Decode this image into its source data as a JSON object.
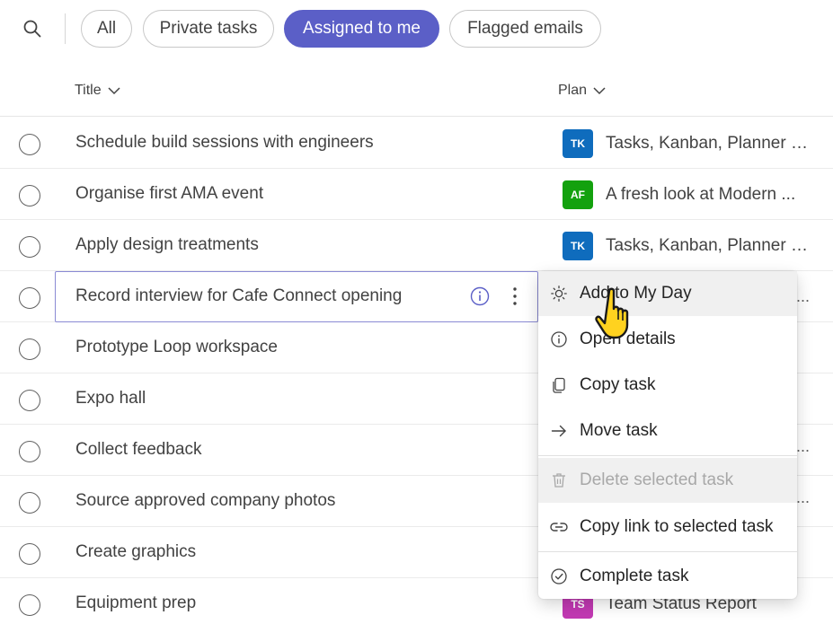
{
  "filters": {
    "all": "All",
    "private": "Private tasks",
    "assigned": "Assigned to me",
    "flagged": "Flagged emails"
  },
  "columns": {
    "title": "Title",
    "plan": "Plan"
  },
  "rows": [
    {
      "title": "Schedule build sessions with engineers",
      "badge": "TK",
      "badge_color": "#0f6cbd",
      "plan": "Tasks, Kanban, Planner i..."
    },
    {
      "title": "Organise first AMA event",
      "badge": "AF",
      "badge_color": "#13a10e",
      "plan": "A fresh look at Modern ..."
    },
    {
      "title": "Apply design treatments",
      "badge": "TK",
      "badge_color": "#0f6cbd",
      "plan": "Tasks, Kanban, Planner i..."
    },
    {
      "title": "Record interview for Cafe Connect opening",
      "trail": "..."
    },
    {
      "title": "Prototype Loop workspace"
    },
    {
      "title": "Expo hall"
    },
    {
      "title": "Collect feedback",
      "trail": "..."
    },
    {
      "title": "Source approved company photos",
      "trail": "..."
    },
    {
      "title": "Create graphics"
    },
    {
      "title": "Equipment prep",
      "badge": "TS",
      "badge_color": "#c239b3",
      "plan": "Team Status Report"
    }
  ],
  "menu": {
    "add_my_day": "Add to My Day",
    "open_details": "Open details",
    "copy_task": "Copy task",
    "move_task": "Move task",
    "delete_task": "Delete selected task",
    "copy_link": "Copy link to selected task",
    "complete_task": "Complete task"
  },
  "icons": {
    "search": "search-icon",
    "chevron": "chevron-down-icon",
    "info": "info-icon",
    "more": "more-vertical-icon",
    "sun": "sun-icon",
    "copy": "copy-icon",
    "arrow": "arrow-right-icon",
    "trash": "trash-icon",
    "link": "link-icon",
    "check": "checkmark-circle-icon",
    "cursor": "hand-pointer-icon"
  },
  "colors": {
    "accent": "#5b5fc7"
  }
}
